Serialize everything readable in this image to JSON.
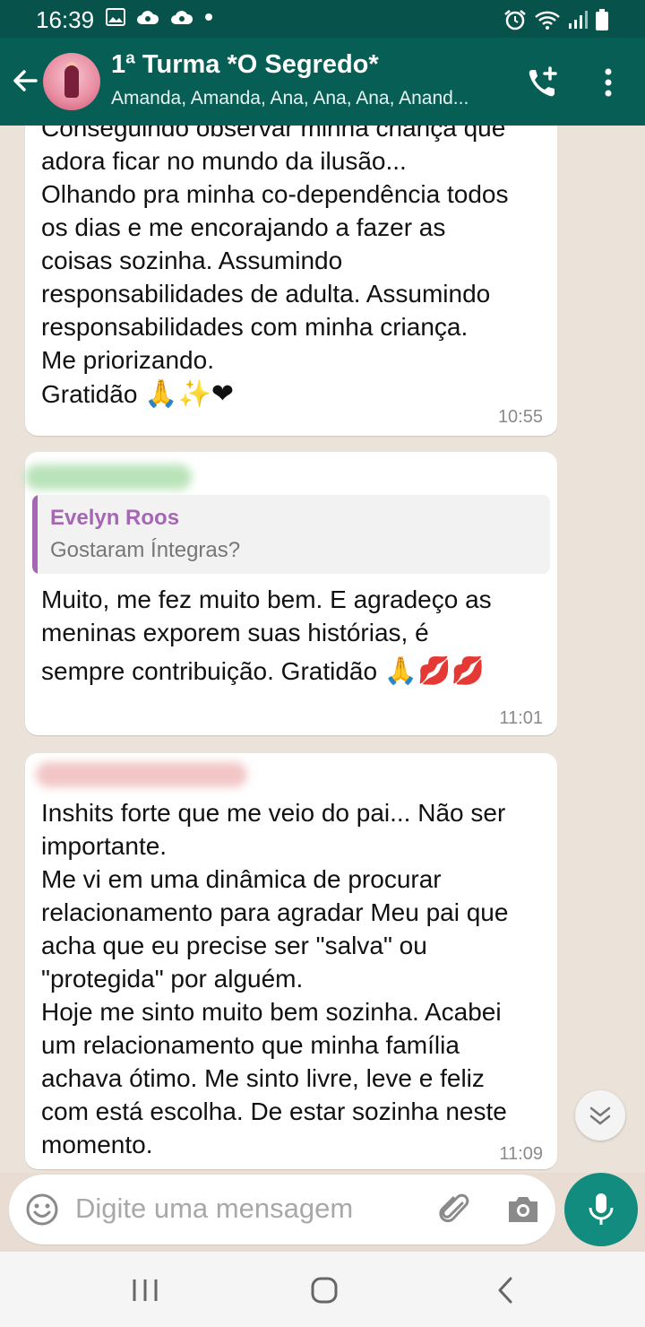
{
  "status_bar": {
    "time": "16:39",
    "left_icons": [
      "image-icon",
      "cloud-icon",
      "cloud-icon",
      "dot-icon"
    ],
    "right_icons": [
      "alarm-icon",
      "wifi-icon",
      "signal-icon",
      "battery-icon"
    ]
  },
  "header": {
    "title": "1ª Turma *O Segredo*",
    "members": "Amanda, Amanda, Ana, Ana, Ana, Anand...",
    "avatar_icon": "group-avatar",
    "actions": [
      "add-call-icon",
      "more-vert-icon"
    ]
  },
  "messages": [
    {
      "text": "Conseguindo observar minha criança que\nadora ficar no mundo da ilusão...\nOlhando pra minha co-dependência todos\nos dias e me encorajando a fazer as\ncoisas sozinha. Assumindo\nresponsabilidades de adulta. Assumindo\nresponsabilidades com minha criança.\nMe priorizando.",
      "last_line": "Gratidão",
      "emojis": "🙏✨❤",
      "time": "10:55"
    },
    {
      "sender_color": "#9ccf9f",
      "quote": {
        "author": "Evelyn Roos",
        "text": "Gostaram Íntegras?"
      },
      "text": "Muito, me fez muito bem. E agradeço as\nmeninas exporem suas histórias, é",
      "last_line": "sempre contribuição. Gratidão",
      "emojis": "🙏💋💋",
      "time": "11:01"
    },
    {
      "sender_color": "#f0b7b7",
      "text": "Inshits forte que me veio do pai... Não ser\nimportante.\nMe vi em uma dinâmica de procurar\nrelacionamento para agradar Meu pai que\nacha  que eu precise ser \"salva\" ou\n\"protegida\" por alguém.\nHoje me sinto muito bem sozinha. Acabei\num relacionamento que minha família\nachava ótimo.  Me sinto livre, leve e feliz\ncom está escolha. De estar sozinha neste\nmomento.",
      "time": "11:09"
    }
  ],
  "input": {
    "placeholder": "Digite uma mensagem"
  },
  "colors": {
    "header": "#075e54",
    "accent": "#128c7e",
    "quote_author": "#a566b3",
    "chat_bg": "#ebe2d9"
  },
  "nav_bar": {
    "items": [
      "recent-apps-icon",
      "home-icon",
      "back-icon"
    ]
  }
}
